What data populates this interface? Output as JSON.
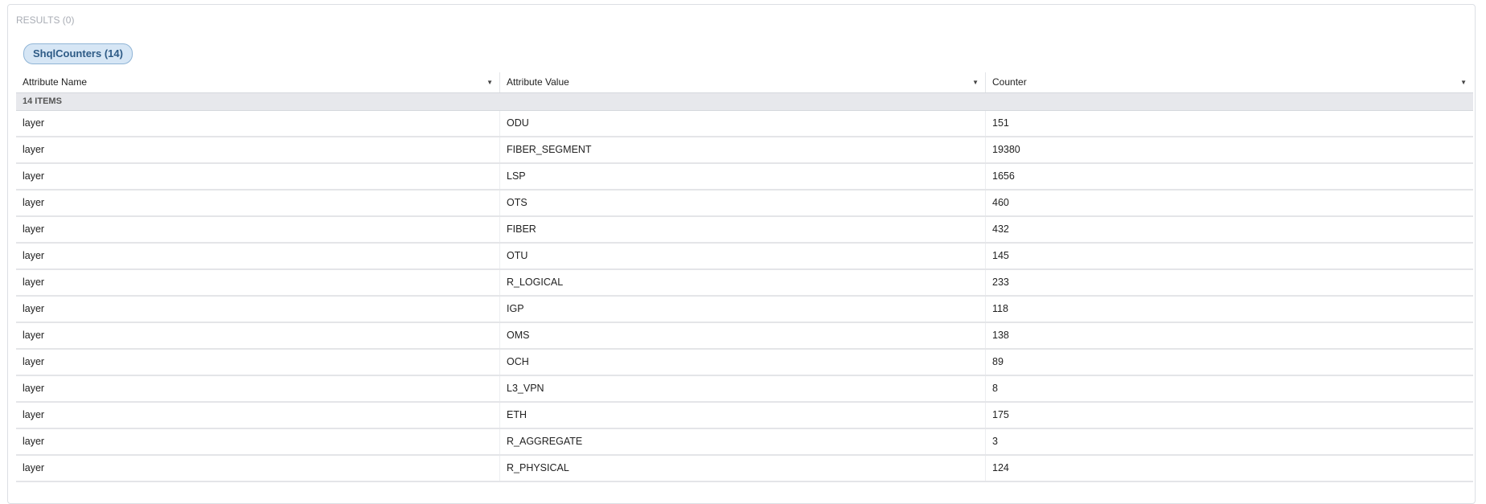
{
  "results_label": "RESULTS (0)",
  "tab": {
    "label": "ShqlCounters (14)"
  },
  "columns": [
    "Attribute Name",
    "Attribute Value",
    "Counter"
  ],
  "group_label": "14 ITEMS",
  "rows": [
    [
      "layer",
      "ODU",
      "151"
    ],
    [
      "layer",
      "FIBER_SEGMENT",
      "19380"
    ],
    [
      "layer",
      "LSP",
      "1656"
    ],
    [
      "layer",
      "OTS",
      "460"
    ],
    [
      "layer",
      "FIBER",
      "432"
    ],
    [
      "layer",
      "OTU",
      "145"
    ],
    [
      "layer",
      "R_LOGICAL",
      "233"
    ],
    [
      "layer",
      "IGP",
      "118"
    ],
    [
      "layer",
      "OMS",
      "138"
    ],
    [
      "layer",
      "OCH",
      "89"
    ],
    [
      "layer",
      "L3_VPN",
      "8"
    ],
    [
      "layer",
      "ETH",
      "175"
    ],
    [
      "layer",
      "R_AGGREGATE",
      "3"
    ],
    [
      "layer",
      "R_PHYSICAL",
      "124"
    ]
  ]
}
